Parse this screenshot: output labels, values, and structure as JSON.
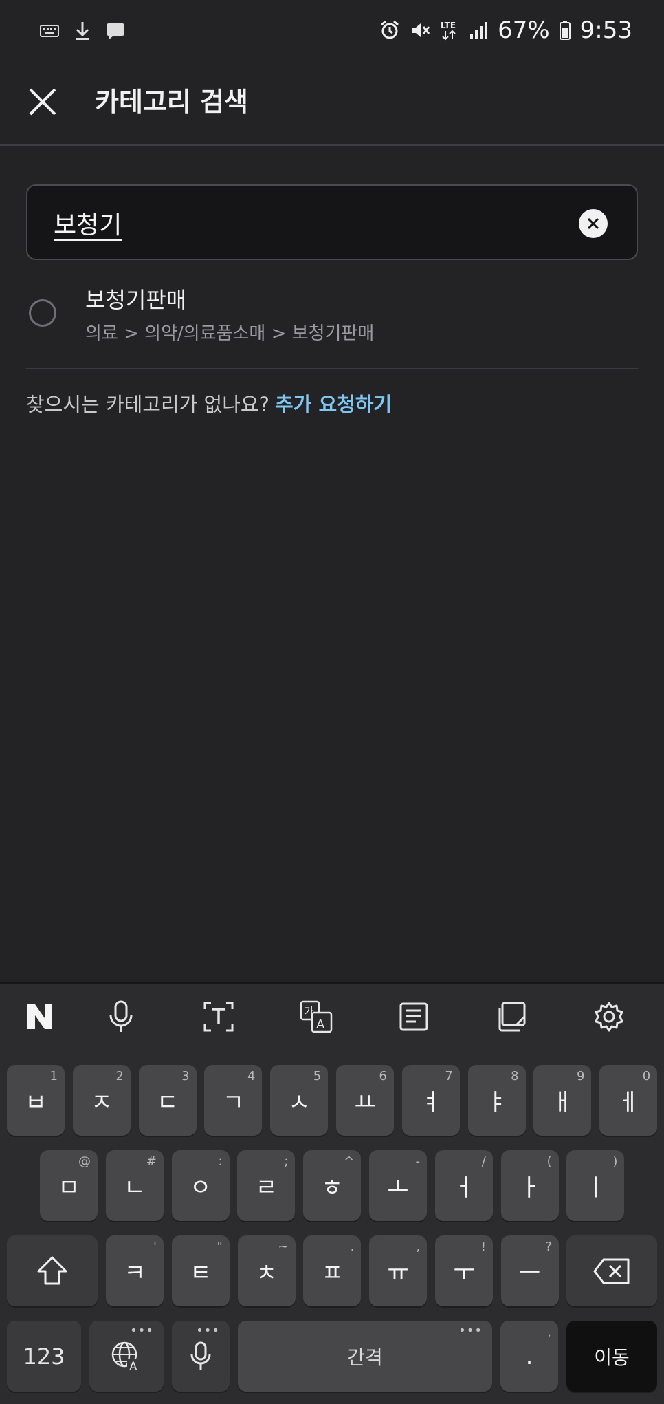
{
  "status_bar": {
    "battery": "67%",
    "time": "9:53"
  },
  "header": {
    "title": "카테고리 검색"
  },
  "search": {
    "value": "보청기"
  },
  "results": [
    {
      "title": "보청기판매",
      "path": "의료 > 의약/의료품소매 > 보청기판매"
    }
  ],
  "request": {
    "question": "찾으시는 카테고리가 없나요?",
    "link": "추가 요청하기"
  },
  "keyboard": {
    "row1": [
      {
        "k": "ㅂ",
        "h": "1"
      },
      {
        "k": "ㅈ",
        "h": "2"
      },
      {
        "k": "ㄷ",
        "h": "3"
      },
      {
        "k": "ㄱ",
        "h": "4"
      },
      {
        "k": "ㅅ",
        "h": "5"
      },
      {
        "k": "ㅛ",
        "h": "6"
      },
      {
        "k": "ㅕ",
        "h": "7"
      },
      {
        "k": "ㅑ",
        "h": "8"
      },
      {
        "k": "ㅐ",
        "h": "9"
      },
      {
        "k": "ㅔ",
        "h": "0"
      }
    ],
    "row2": [
      {
        "k": "ㅁ",
        "h": "@"
      },
      {
        "k": "ㄴ",
        "h": "#"
      },
      {
        "k": "ㅇ",
        "h": ":"
      },
      {
        "k": "ㄹ",
        "h": ";"
      },
      {
        "k": "ㅎ",
        "h": "^"
      },
      {
        "k": "ㅗ",
        "h": "-"
      },
      {
        "k": "ㅓ",
        "h": "/"
      },
      {
        "k": "ㅏ",
        "h": "("
      },
      {
        "k": "ㅣ",
        "h": ")"
      }
    ],
    "row3": [
      {
        "k": "ㅋ",
        "h": "'"
      },
      {
        "k": "ㅌ",
        "h": "\""
      },
      {
        "k": "ㅊ",
        "h": "~"
      },
      {
        "k": "ㅍ",
        "h": "."
      },
      {
        "k": "ㅠ",
        "h": ","
      },
      {
        "k": "ㅜ",
        "h": "!"
      },
      {
        "k": "ㅡ",
        "h": "?"
      }
    ],
    "num_label": "123",
    "space_label": "간격",
    "period_label": ".",
    "period_hint": ",",
    "enter_label": "이동"
  },
  "icons": {
    "close": "close-icon",
    "clear": "clear-icon",
    "shift": "shift-icon",
    "backspace": "backspace-icon",
    "globe": "globe-icon",
    "mic": "mic-icon"
  }
}
